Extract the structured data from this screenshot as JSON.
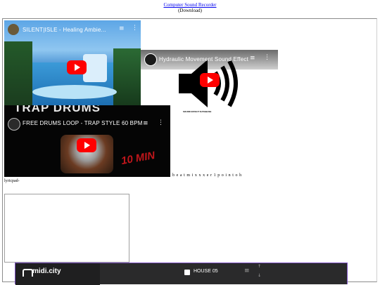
{
  "header": {
    "link": "Computer Sound Recorder",
    "sub": "(Download)"
  },
  "videos": [
    {
      "title": "SILENT|ISLE - Healing Ambie..."
    },
    {
      "title": "Hydraulic Movement Sound Effect"
    },
    {
      "title": "FREE DRUMS LOOP - TRAP STYLE 60 BPM"
    }
  ],
  "overlays": {
    "trap_drums": "TRAP DRUMS",
    "ten_min": "10 MIN",
    "sound_effect_caption": "SOUND EFFECT DATABASE"
  },
  "inline_text": "beatmixxxer1pointoh",
  "lyricpad_label": "lyricpad-",
  "midi": {
    "brand": "midi.city",
    "preset": "HOUSE 05"
  },
  "colors": {
    "link": "#0000ee",
    "play": "#ff0000",
    "midi_bg": "#2a2a2b",
    "midi_border": "#7a4fc0"
  }
}
